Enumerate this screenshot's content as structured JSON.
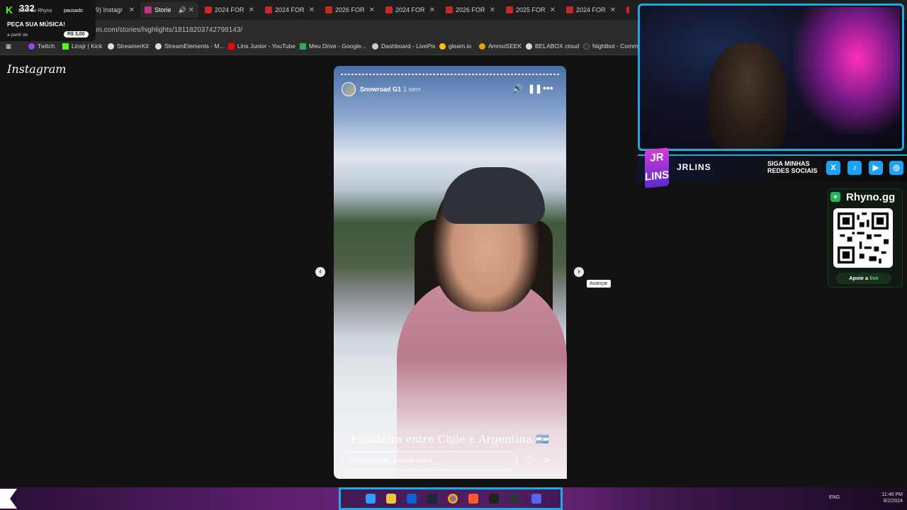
{
  "browser": {
    "tabs": [
      {
        "label": "(9) Instagr",
        "active": false
      },
      {
        "label": "Storie",
        "active": true
      },
      {
        "label": "2024 FOR",
        "active": false
      },
      {
        "label": "2024 FOR",
        "active": false
      },
      {
        "label": "2026 FOR",
        "active": false
      },
      {
        "label": "2024 FOR",
        "active": false
      },
      {
        "label": "2026 FOR",
        "active": false
      },
      {
        "label": "2025 FOR",
        "active": false
      },
      {
        "label": "2024 FOR",
        "active": false
      }
    ],
    "url": "instagram.com/stories/highlights/18118203742798143/",
    "bookmarks": [
      {
        "label": "Twitch",
        "color": "#9146ff"
      },
      {
        "label": "Linsjr | Kick",
        "color": "#53fc18"
      },
      {
        "label": "StreamerKit",
        "color": "#dddddd"
      },
      {
        "label": "StreamElements - M...",
        "color": "#dddddd"
      },
      {
        "label": "Lins Junior - YouTube",
        "color": "#ff0000"
      },
      {
        "label": "Meu Drive - Google...",
        "color": "#34a853"
      },
      {
        "label": "Dashboard - LivePix",
        "color": "#cccccc"
      },
      {
        "label": "gleam.io",
        "color": "#ffc400"
      },
      {
        "label": "AmmoSEEK",
        "color": "#e0a400"
      },
      {
        "label": "BELABOX cloud",
        "color": "#dddddd"
      },
      {
        "label": "Nightbot - Comm",
        "color": "#333333"
      }
    ]
  },
  "kick_widget": {
    "count": "332",
    "blurb": "Baile do Rhyno",
    "paused": "pausado",
    "request": "PEÇA SUA MÚSICA!",
    "from": "a partir de",
    "price": "R$ 3,00"
  },
  "instagram": {
    "logo": "Instagram",
    "story": {
      "username": "Snowroad G1",
      "time": "1 sem",
      "caption": "Fronteira entre Chile e Argentina 🇦🇷",
      "reply_placeholder": "Responder a _habitatnatural_...",
      "tooltip": "Avançar"
    }
  },
  "overlay": {
    "channel": "JRLINS",
    "social_cta": "SIGA MINHAS REDES SOCIAIS",
    "social_icons": [
      "x-icon",
      "tiktok-icon",
      "youtube-icon",
      "instagram-icon"
    ],
    "rhyno_title": "Rhyno.gg",
    "apoie_label": "Apoie a",
    "apoie_live": "live"
  },
  "taskbar": {
    "lang": "ENG",
    "time": "11:46 PM",
    "date": "8/2/2024"
  },
  "colors": {
    "accent_blue": "#23a8e6",
    "kick_green": "#53fc18",
    "magenta": "#d43bd6"
  }
}
